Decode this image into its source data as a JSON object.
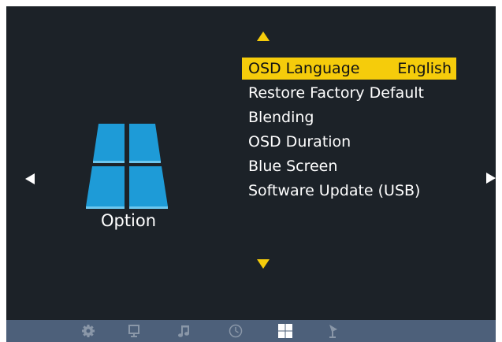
{
  "menu": {
    "title": "Option",
    "icon": "windows-tiles-icon",
    "items": [
      {
        "label": "OSD Language",
        "value": "English",
        "selected": true
      },
      {
        "label": "Restore Factory Default",
        "value": "",
        "selected": false
      },
      {
        "label": "Blending",
        "value": "",
        "selected": false
      },
      {
        "label": "OSD Duration",
        "value": "",
        "selected": false
      },
      {
        "label": "Blue Screen",
        "value": "",
        "selected": false
      },
      {
        "label": "Software Update (USB)",
        "value": "",
        "selected": false
      }
    ]
  },
  "navigation": {
    "left": "triangle-left-icon",
    "right": "triangle-right-icon",
    "up": "triangle-up-icon",
    "down": "triangle-down-icon"
  },
  "bottom_tabs": [
    {
      "icon": "gear-icon",
      "active": false
    },
    {
      "icon": "monitor-icon",
      "active": false
    },
    {
      "icon": "music-note-icon",
      "active": false
    },
    {
      "icon": "clock-icon",
      "active": false
    },
    {
      "icon": "option-tiles-icon",
      "active": true
    },
    {
      "icon": "antenna-icon",
      "active": false
    }
  ],
  "colors": {
    "background": "#1c2228",
    "highlight": "#f5cc0b",
    "bottom_bar": "#4d607a",
    "icon_blue": "#1e9bd7",
    "inactive_icon": "#8a97a8"
  }
}
